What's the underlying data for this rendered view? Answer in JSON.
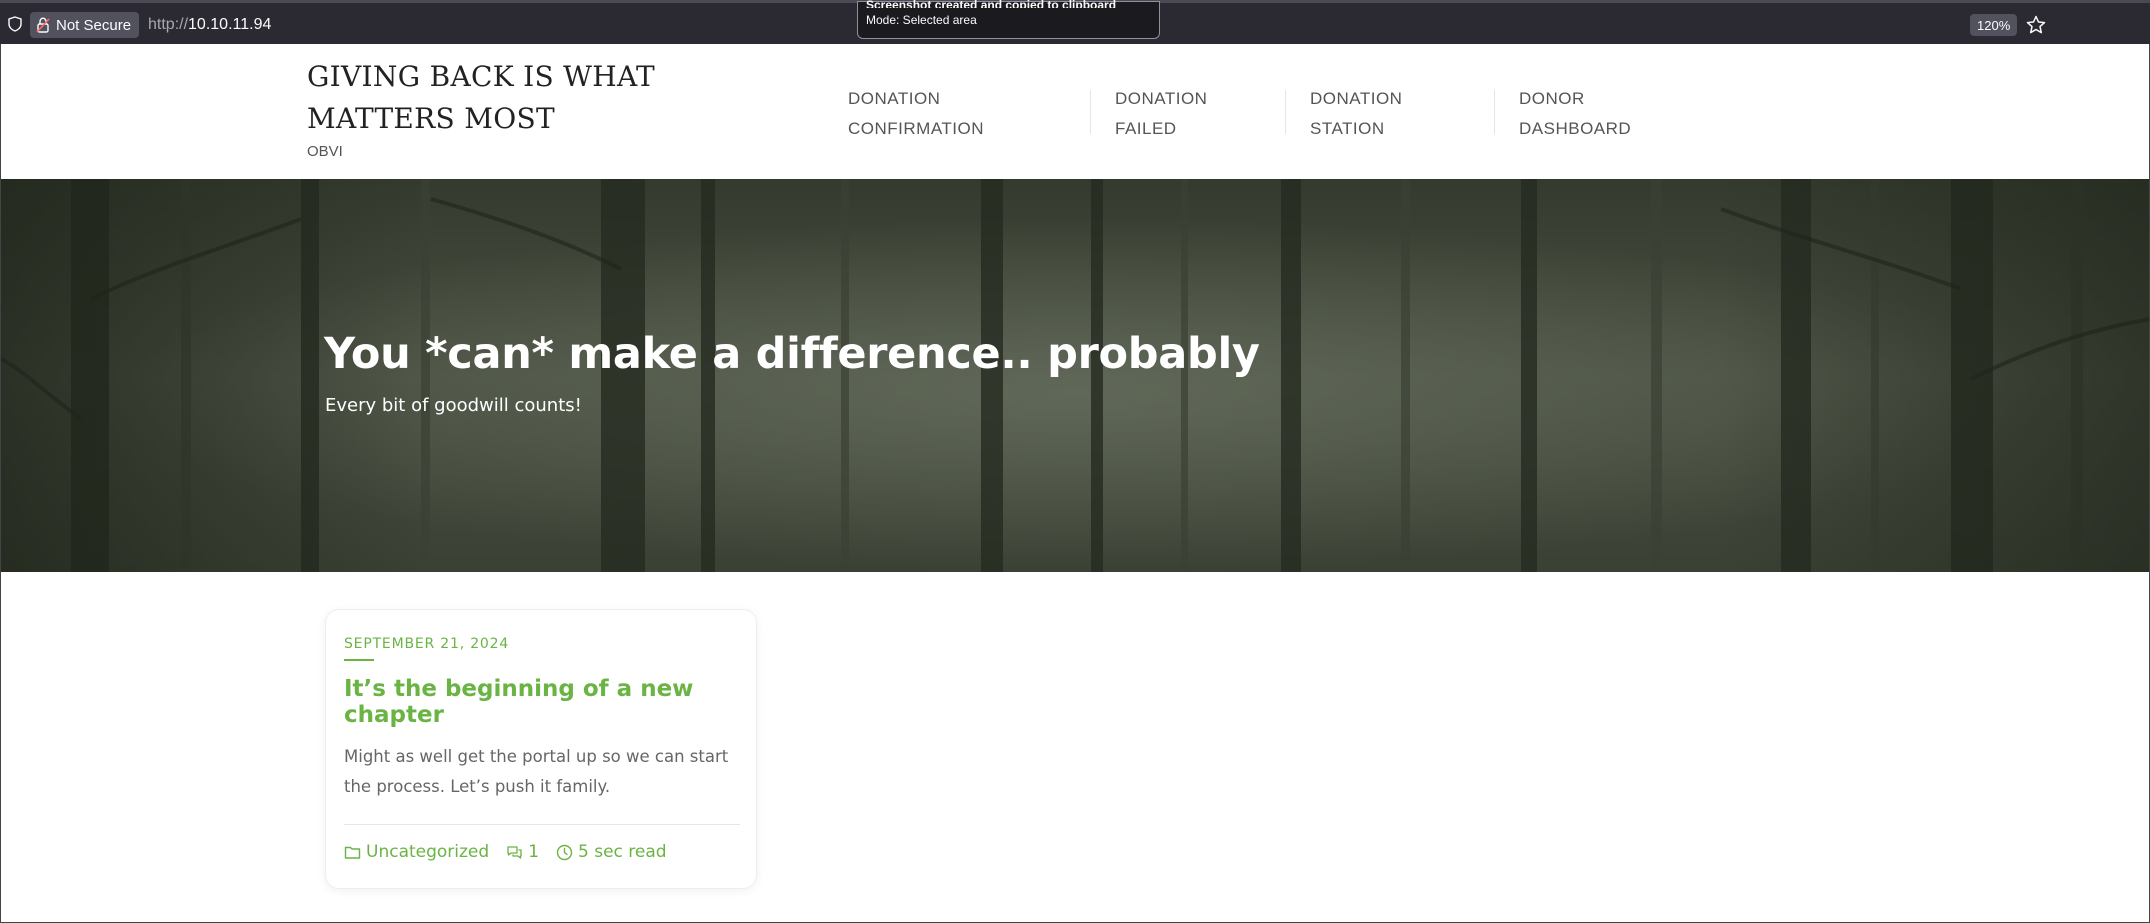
{
  "browser": {
    "security_label": "Not Secure",
    "url_scheme": "http://",
    "url_host": "10.10.11.94",
    "zoom": "120%",
    "toast_title": "Screenshot created and copied to clipboard",
    "toast_mode": "Mode: Selected area"
  },
  "site": {
    "title": "GIVING BACK IS WHAT MATTERS MOST",
    "tagline": "OBVI"
  },
  "nav": {
    "items": [
      {
        "line1": "DONATION",
        "line2": "CONFIRMATION"
      },
      {
        "line1": "DONATION",
        "line2": "FAILED"
      },
      {
        "line1": "DONATION",
        "line2": "STATION"
      },
      {
        "line1": "DONOR",
        "line2": "DASHBOARD"
      }
    ]
  },
  "hero": {
    "title": "You *can* make a difference.. probably",
    "subtitle": "Every bit of goodwill counts!"
  },
  "post": {
    "date": "SEPTEMBER 21, 2024",
    "title": "It’s the beginning of a new chapter",
    "excerpt": "Might as well get the portal up so we can start the process. Let’s push it family.",
    "category": "Uncategorized",
    "comments": "1",
    "read_time": "5 sec read"
  },
  "icons": {
    "shield": "shield-icon",
    "lock": "lock-insecure-icon",
    "star": "bookmark-star-icon",
    "folder": "folder-icon",
    "comments": "comments-icon",
    "clock": "clock-icon"
  },
  "colors": {
    "accent_green": "#6ab443",
    "chrome_bg": "#2b2a33",
    "hero_bg": "#3c4437"
  }
}
